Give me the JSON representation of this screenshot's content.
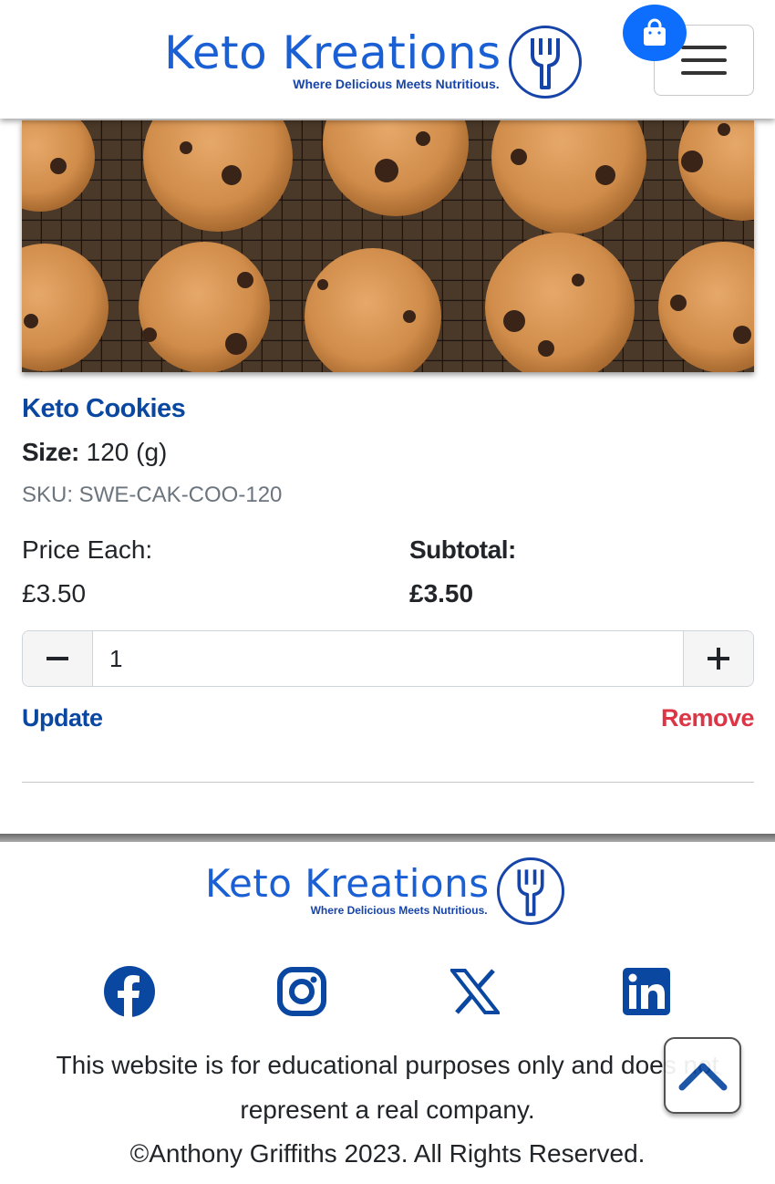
{
  "brand": {
    "name": "Keto Kreations",
    "tagline": "Where Delicious Meets Nutritious.",
    "primary_color": "#1a5fd4",
    "dark_color": "#1744a8"
  },
  "header": {
    "cart_icon": "shopping-bag-icon",
    "menu_icon": "hamburger-menu-icon"
  },
  "product": {
    "image_alt": "Keto Cookies",
    "title": "Keto Cookies",
    "size_label": "Size:",
    "size_value": "120 (g)",
    "sku": "SKU: SWE-CAK-COO-120",
    "price_label": "Price Each:",
    "price_value": "£3.50",
    "subtotal_label": "Subtotal:",
    "subtotal_value": "£3.50",
    "quantity": "1",
    "update_label": "Update",
    "remove_label": "Remove",
    "remove_color": "#dc3545"
  },
  "footer": {
    "social": [
      {
        "name": "facebook-icon"
      },
      {
        "name": "instagram-icon"
      },
      {
        "name": "x-twitter-icon"
      },
      {
        "name": "linkedin-icon"
      }
    ],
    "disclaimer_line1": "This website is for educational purposes only and does not",
    "disclaimer_line2": "represent a real company.",
    "copyright": "©Anthony Griffiths 2023. All Rights Reserved."
  }
}
